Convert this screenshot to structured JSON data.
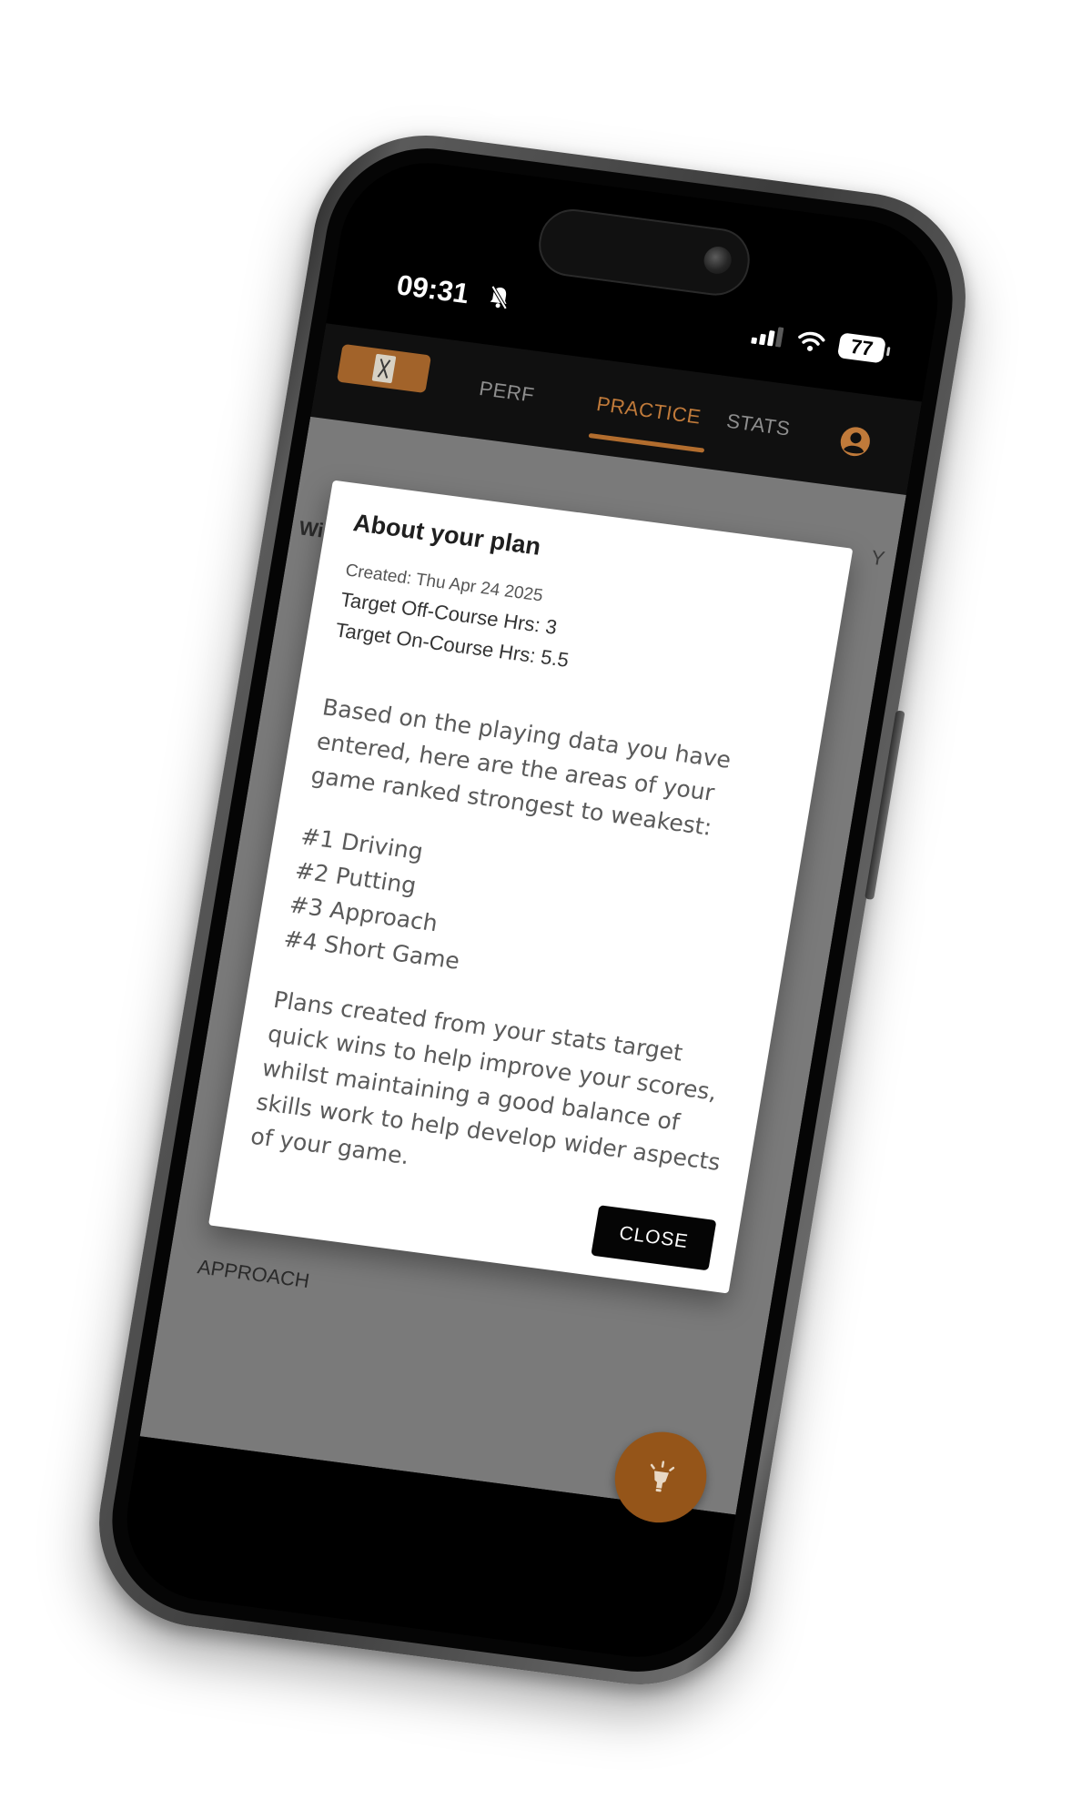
{
  "status_bar": {
    "time": "09:31",
    "battery_level": "77",
    "icons": [
      "bell-slash-icon",
      "cellular-signal-icon",
      "wifi-icon",
      "battery-icon"
    ]
  },
  "nav": {
    "logo_icon": "app-logo-icon",
    "tabs": [
      {
        "label": "PERF",
        "active": false
      },
      {
        "label": "PRACTICE",
        "active": true
      },
      {
        "label": "STATS",
        "active": false
      }
    ],
    "account_icon": "account-circle-icon"
  },
  "background": {
    "partial_label_left": "Wi",
    "partial_label_right": "Y",
    "section_label": "APPROACH"
  },
  "modal": {
    "title": "About your plan",
    "created": "Created: Thu Apr 24 2025",
    "target_off_course": "Target Off-Course Hrs: 3",
    "target_on_course": "Target On-Course Hrs: 5.5",
    "intro": "Based on the playing data you have entered, here are the areas of your game ranked strongest to weakest:",
    "ranking": [
      "#1 Driving",
      "#2 Putting",
      "#3 Approach",
      "#4 Short Game"
    ],
    "outro": "Plans created from your stats target quick wins to help improve your scores, whilst maintaining a good balance of skills work to help develop wider aspects of your game.",
    "close_label": "CLOSE"
  },
  "fab": {
    "icon": "lightbulb-icon"
  },
  "colors": {
    "accent": "#a2632a",
    "active_tab": "#c07a3a",
    "nav_background": "#101010",
    "overlay_background": "#7a7a7a",
    "fab": "#955519"
  }
}
